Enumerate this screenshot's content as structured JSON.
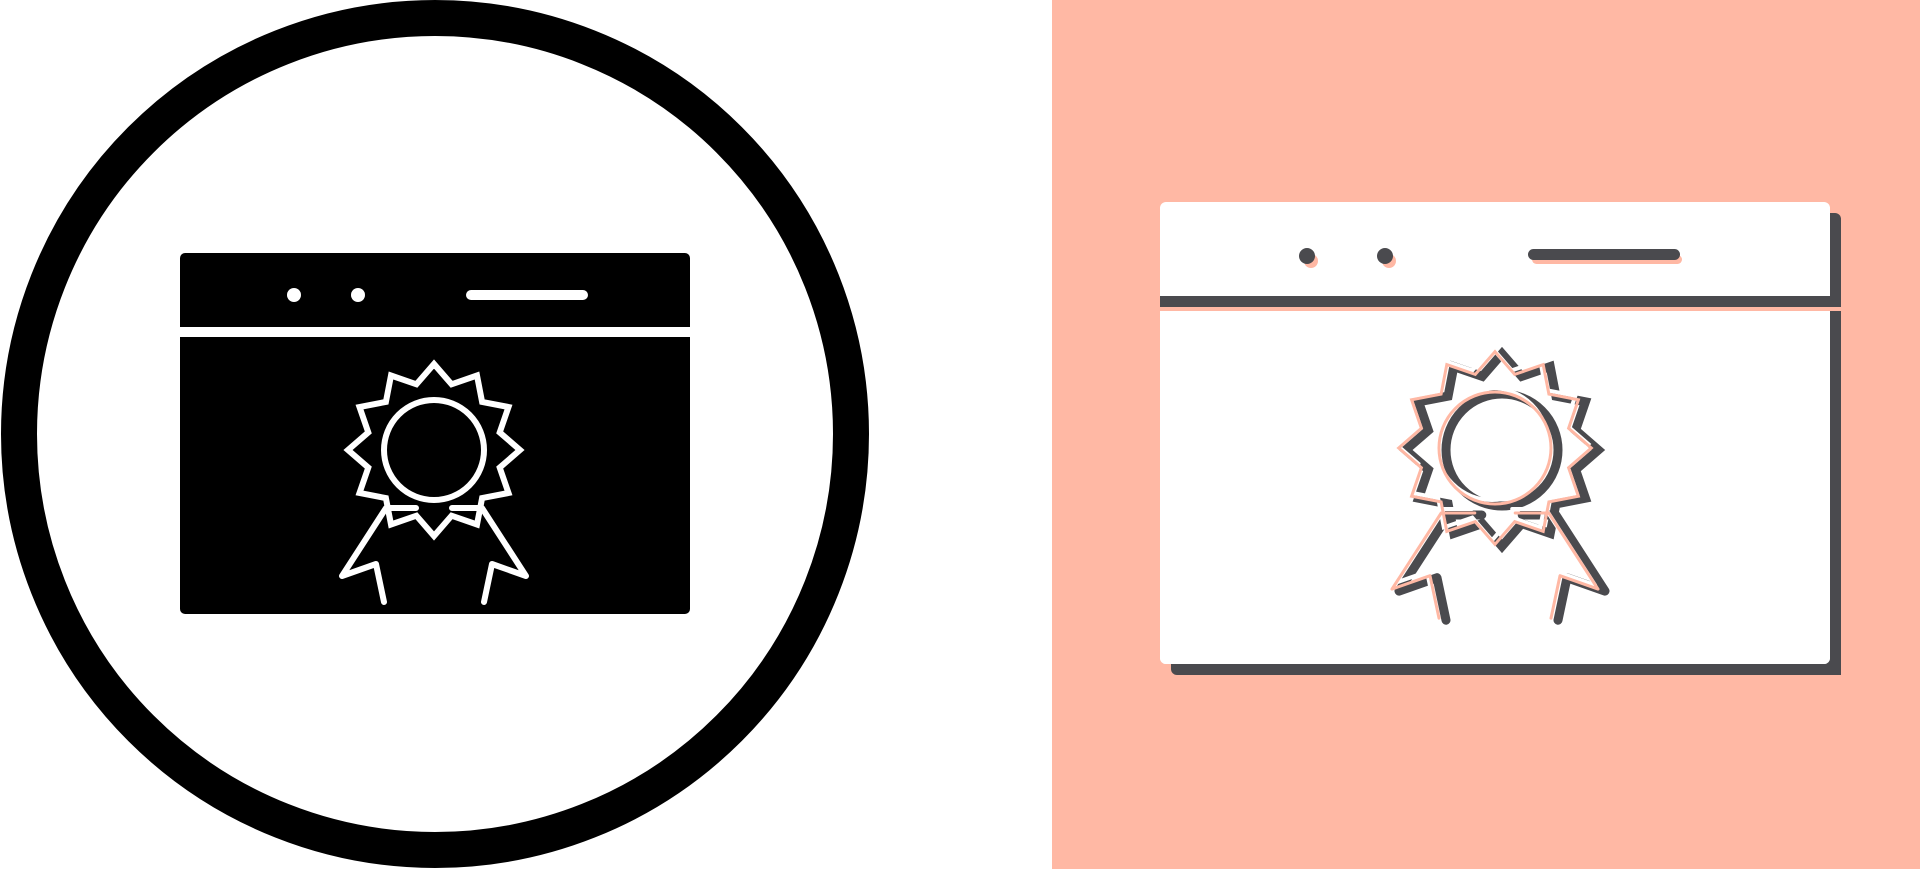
{
  "canvas": {
    "background": "#ffffff"
  },
  "icons": [
    {
      "name": "browser-certificate-glyph-icon",
      "style": "glyph",
      "colors": {
        "ring": "#000000",
        "window": "#000000",
        "detail": "#ffffff"
      }
    },
    {
      "name": "browser-certificate-duotone-icon",
      "style": "flat-duotone",
      "colors": {
        "panel_background": "#ffb8a4",
        "window": "#ffffff",
        "shadow": "#4a4a4e",
        "accent": "#ffb8a4"
      }
    }
  ],
  "badge_points": 12
}
